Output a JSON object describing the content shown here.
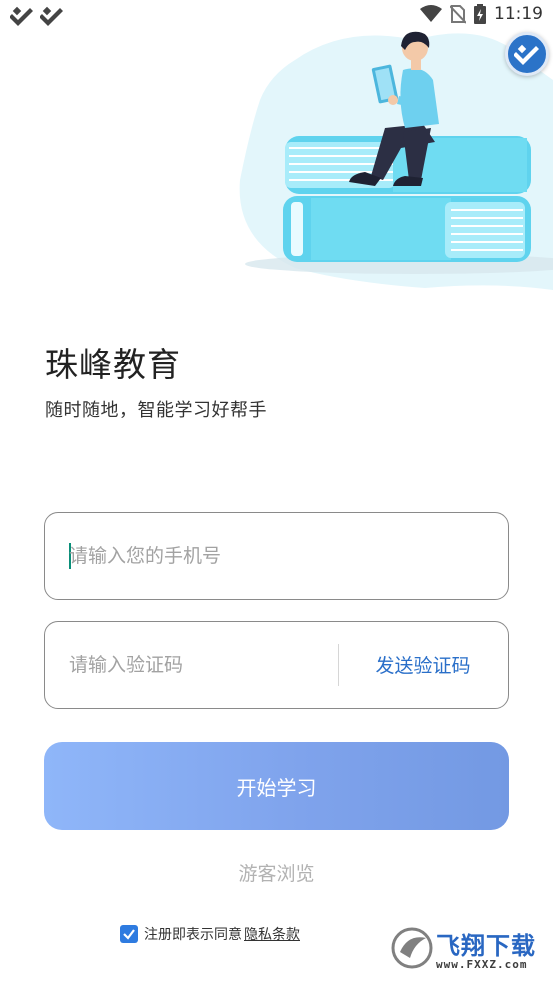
{
  "status_bar": {
    "time": "11:19",
    "icons": [
      "app-notification-icon",
      "app-notification-icon",
      "wifi-icon",
      "no-sim-icon",
      "battery-charging-icon"
    ]
  },
  "hero": {
    "illustration": "person-reading-on-books-illustration",
    "colors": {
      "book": "#5fd3ee",
      "blob": "#e3f6fb",
      "shirt": "#6ed0ef",
      "pants": "#2c2f44"
    }
  },
  "floating_logo": {
    "icon": "app-logo-icon",
    "color": "#2b73c8"
  },
  "brand": {
    "title": "珠峰教育",
    "subtitle": "随时随地，智能学习好帮手"
  },
  "phone_field": {
    "value": "",
    "placeholder": "请输入您的手机号"
  },
  "code_field": {
    "value": "",
    "placeholder": "请输入验证码",
    "send_label": "发送验证码"
  },
  "start_button": {
    "label": "开始学习"
  },
  "guest_link": {
    "label": "游客浏览"
  },
  "agreement": {
    "checked": true,
    "text": "注册即表示同意",
    "link": "隐私条款"
  },
  "watermark": {
    "text": "飞翔下载",
    "url": "www.FXXZ.com"
  },
  "colors": {
    "accent": "#2a6fc9",
    "button_start": "#8fb6f9",
    "button_end": "#7399e3",
    "checkbox": "#2e7be0"
  }
}
